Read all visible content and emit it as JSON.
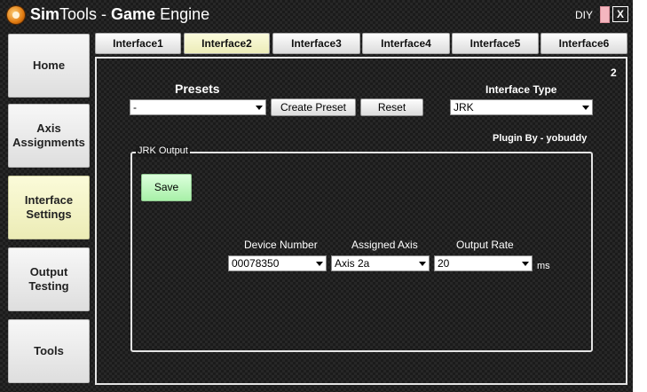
{
  "titlebar": {
    "title_part1": "Sim",
    "title_part2": "Tools - ",
    "title_part3": "Game",
    "title_part4": " Engine",
    "diy_label": "DIY",
    "close_glyph": "X"
  },
  "sidebar": {
    "items": [
      {
        "label": "Home",
        "active": false
      },
      {
        "label": "Axis\nAssignments",
        "active": false
      },
      {
        "label": "Interface\nSettings",
        "active": true
      },
      {
        "label": "Output\nTesting",
        "active": false
      },
      {
        "label": "Tools",
        "active": false
      }
    ]
  },
  "tabs": [
    {
      "label": "Interface1",
      "active": false
    },
    {
      "label": "Interface2",
      "active": true
    },
    {
      "label": "Interface3",
      "active": false
    },
    {
      "label": "Interface4",
      "active": false
    },
    {
      "label": "Interface5",
      "active": false
    },
    {
      "label": "Interface6",
      "active": false
    }
  ],
  "main": {
    "panel_number": "2",
    "presets_label": "Presets",
    "presets_value": "-",
    "create_preset_label": "Create Preset",
    "reset_label": "Reset",
    "interface_type_label": "Interface Type",
    "interface_type_value": "JRK",
    "plugin_by": "Plugin By - yobuddy",
    "group_title": "JRK Output",
    "save_label": "Save",
    "device_number_label": "Device Number",
    "device_number_value": "00078350",
    "assigned_axis_label": "Assigned Axis",
    "assigned_axis_value": "Axis 2a",
    "output_rate_label": "Output Rate",
    "output_rate_value": "20",
    "output_rate_unit": "ms"
  },
  "colors": {
    "active_tab": "#f2f2c4",
    "save_button": "#c8f8c8",
    "background": "#1b1b1b"
  }
}
